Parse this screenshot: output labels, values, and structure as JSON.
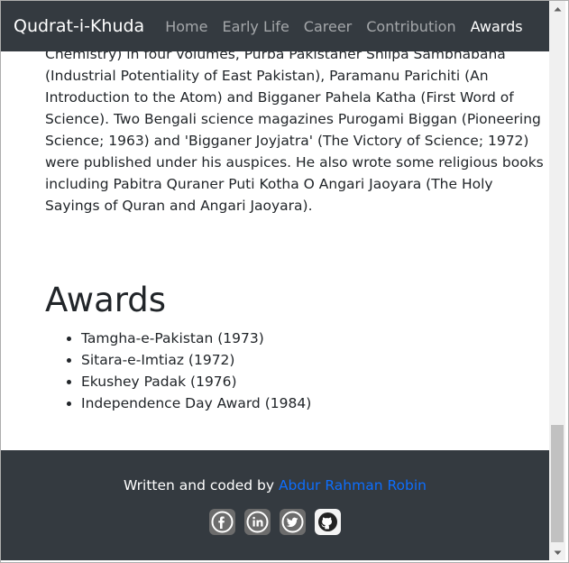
{
  "navbar": {
    "brand": "Qudrat-i-Khuda",
    "links": [
      {
        "label": "Home"
      },
      {
        "label": "Early Life"
      },
      {
        "label": "Career"
      },
      {
        "label": "Contribution"
      },
      {
        "label": "Awards",
        "active": true
      }
    ]
  },
  "content": {
    "paragraph_lines": [
      "Chemistry) in four volumes, Purba Pakistaner Shilpa Sambhabana",
      "(Industrial Potentiality of East Pakistan), Paramanu Parichiti (An",
      "Introduction to the Atom) and Bigganer Pahela Katha (First Word of",
      "Science). Two Bengali science magazines Purogami Biggan (Pioneering",
      "Science; 1963) and 'Bigganer Joyjatra' (The Victory of Science; 1972)",
      "were published under his auspices. He also wrote some religious books",
      "including Pabitra Quraner Puti Kotha O Angari Jaoyara (The Holy",
      "Sayings of Quran and Angari Jaoyara)."
    ],
    "awards_heading": "Awards",
    "awards": [
      "Tamgha-e-Pakistan (1973)",
      "Sitara-e-Imtiaz (1972)",
      "Ekushey Padak (1976)",
      "Independence Day Award (1984)"
    ]
  },
  "footer": {
    "credit_prefix": "Written and coded by",
    "author": "Abdur Rahman Robin",
    "social_icons": [
      "facebook-icon",
      "linkedin-icon",
      "twitter-icon",
      "github-icon"
    ]
  },
  "colors": {
    "navbar_bg": "#343a40",
    "link_accent": "#0d6efd"
  }
}
